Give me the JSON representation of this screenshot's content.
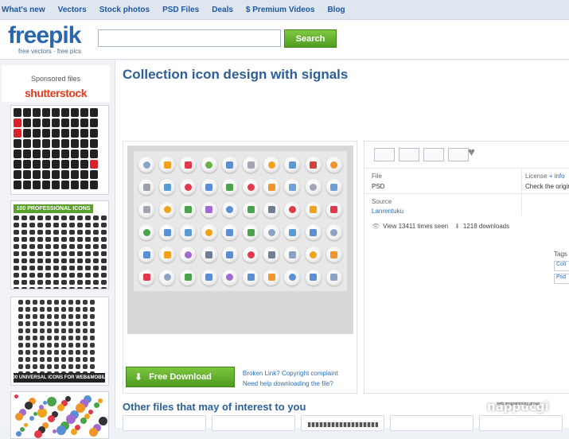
{
  "topnav": {
    "items": [
      "What's new",
      "Vectors",
      "Stock photos",
      "PSD Files",
      "Deals",
      "$ Premium Videos",
      "Blog"
    ]
  },
  "header": {
    "logo": "freepik",
    "tagline": "free vectors · free pics",
    "search_placeholder": "",
    "search_button": "Search"
  },
  "sidebar": {
    "sponsored_label": "Sponsored files",
    "sponsor_brand": "shutterstock",
    "thumb2_banner": "100 PROFESSIONAL ICONS",
    "thumb3_banner": "100 UNIVERSAL ICONS FOR WEB&MOBILE"
  },
  "main": {
    "title": "Collection icon design with signals",
    "download_button": "Free Download",
    "broken_link": "Broken Link?",
    "copyright": "Copyright complaint",
    "help_download": "Need help downloading the file?",
    "other_files_title": "Other files that may of interest to you"
  },
  "info": {
    "file_label": "File",
    "file_value": "PSD",
    "license_label": "License",
    "license_more": "+ info",
    "license_value": "Check the origin",
    "source_label": "Source",
    "source_value": "Lanrentuku",
    "views": "View 13411 times seen",
    "downloads": "1218 downloads",
    "tags_label": "Tags",
    "tags": [
      "Coll",
      "Psd"
    ]
  },
  "watermark": {
    "text": "nappucgi",
    "sub": "web programming group"
  },
  "colors": {
    "accent_blue": "#2c5f9a",
    "link_blue": "#2c6fb7",
    "button_green": "#5aa22a",
    "shutter_red": "#e23b1f"
  },
  "icon_colors": [
    "#8aa3c4",
    "#f0a21a",
    "#e0394b",
    "#6cb24c",
    "#5b8fd3",
    "#a0a7b3",
    "#f0a21a",
    "#5a9bd4",
    "#d0413c",
    "#f0952a",
    "#9aa0a8",
    "#5a9bd4",
    "#e0394b",
    "#5b8fd3",
    "#4aa34a",
    "#e0394b",
    "#f0952a",
    "#6fa0d8",
    "#a0a7b3",
    "#6f9ed3",
    "#a0a7b3",
    "#f0a21a",
    "#4aa34a",
    "#a26ad0",
    "#5b8fd3",
    "#4aa34a",
    "#6f7f93",
    "#e0394b",
    "#f0a21a",
    "#e0394b",
    "#4aa34a",
    "#5b8fd3",
    "#5a9bd4",
    "#f0a21a",
    "#5b8fd3",
    "#4aa34a",
    "#8aa3c4",
    "#5a9bd4",
    "#5b8fd3",
    "#8aa3c4",
    "#5b8fd3",
    "#f0a21a",
    "#a26ad0",
    "#6f7f93",
    "#5b8fd3",
    "#e0394b",
    "#6f7f93",
    "#8aa3c4",
    "#f0a21a",
    "#f0952a",
    "#e0394b",
    "#8aa3c4",
    "#4aa34a",
    "#5b8fd3",
    "#a26ad0",
    "#5b8fd3",
    "#f0952a",
    "#5b8fd3",
    "#5b8fd3"
  ]
}
